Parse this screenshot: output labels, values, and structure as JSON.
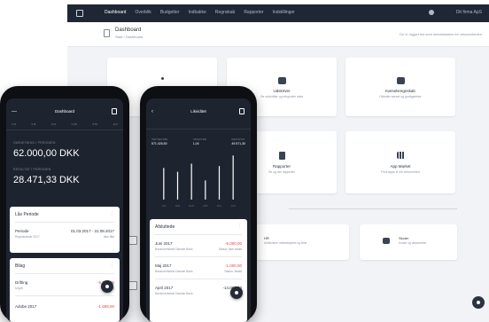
{
  "desktop": {
    "nav": [
      "Dashboard",
      "Overblik",
      "Budgetter",
      "Indbakke",
      "Regnskab",
      "Rapporter",
      "Indstillinger"
    ],
    "user": "Dit firma ApS",
    "page_title": "Dashboard",
    "breadcrumb": "Start / Dashboard",
    "info_text": "Du er logget ind som administrator for virksomheden",
    "cards": [
      {
        "title": "",
        "sub": ""
      },
      {
        "title": "Udskriver",
        "sub": "Se udskrifter og eksporter data"
      },
      {
        "title": "Kørselsregnskab",
        "sub": "Håndter kørsel og godtgørelse"
      },
      {
        "title": "",
        "sub": ""
      },
      {
        "title": "Rapporter",
        "sub": "Se og del rapporter"
      },
      {
        "title": "App Market",
        "sub": "Find apps til din virksomhed"
      }
    ],
    "bottom_cards": [
      {
        "title": "HR",
        "sub": "Administrer medarbejdere og ferie"
      },
      {
        "title": "Skoler",
        "sub": "Kurser og uddannelse"
      }
    ]
  },
  "phone_a": {
    "title": "Dashboard",
    "tabs": [
      "1 M",
      "3 M",
      "6 M",
      "1 ÅR",
      "ÅTD",
      "ALT"
    ],
    "label1": "OMSÆTNING I PERIODEN",
    "value1": "62.000,00 DKK",
    "label2": "RESULTAT I PERIODEN",
    "value2": "28.471,33 DKK",
    "card1": {
      "title": "Lås Periode",
      "row_label": "Periode",
      "row_value": "01.03.2017 - 31.08.2017",
      "row_sub": "Regnskabsår 2017",
      "row_sub2": "Ikke låst"
    },
    "card2": {
      "title": "Bilag",
      "rows": [
        {
          "label": "Drifting",
          "value": "-5.326,25",
          "sub": "Udgift",
          "sub2": "5 bilag"
        },
        {
          "label": "Adobe 2017",
          "value": "-1.699,00",
          "sub": "",
          "sub2": ""
        }
      ]
    }
  },
  "phone_b": {
    "title": "Likviditet",
    "legend": [
      {
        "label": "INDTÆGTER",
        "value": "571.426,50"
      },
      {
        "label": "UDGIFTER",
        "value": "1,04"
      },
      {
        "label": "RESULTAT",
        "value": "49.571,30"
      }
    ],
    "card": {
      "title": "Afsluttede",
      "rows": [
        {
          "label": "Juni 2017",
          "value": "-5.000,00",
          "sub": "Bankoverførsel Danske Bank",
          "sub2": "Status: Ikke betalt"
        },
        {
          "label": "Maj 2017",
          "value": "-1.000,00",
          "sub": "Bankoverførsel Danske Bank",
          "sub2": "Status: Betalt"
        },
        {
          "label": "April 2017",
          "value": "-14.000,00",
          "sub": "Bankoverførsel Danske Bank",
          "sub2": ""
        }
      ]
    }
  },
  "chart_data": {
    "type": "bar",
    "categories": [
      "JAN",
      "FEB",
      "MAR",
      "APR",
      "MAJ",
      "JUN"
    ],
    "values": [
      66,
      58,
      75,
      40,
      70,
      92
    ],
    "title": "",
    "xlabel": "",
    "ylabel": "",
    "ylim": [
      0,
      100
    ]
  },
  "colors": {
    "dark": "#1e242f",
    "accent_red": "#e14a4a",
    "topbar": "#1f2734"
  },
  "icons": [
    "dashboard-icon",
    "car-icon",
    "printer-icon",
    "grid-icon",
    "report-icon",
    "graduation-icon",
    "notification-icon"
  ]
}
